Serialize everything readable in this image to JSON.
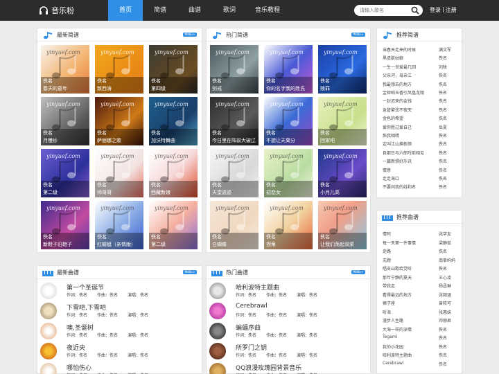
{
  "header": {
    "logo_text": "音乐粉",
    "nav": [
      "首页",
      "简谱",
      "曲谱",
      "歌词",
      "音乐教程"
    ],
    "search_placeholder": "请输入歌名",
    "login": "登录",
    "sep": "|",
    "register": "注册",
    "active_color": "#2f8fe6"
  },
  "latest_jianpu": {
    "title": "最新简谱",
    "more": "MORE>>",
    "items": [
      {
        "name": "佚名",
        "sub": "春天的童年",
        "wm": "yinyuef.com"
      },
      {
        "name": "佚名",
        "sub": "致西涛",
        "wm": "yinyuef.com"
      },
      {
        "name": "佚名",
        "sub": "第四级",
        "wm": "yinyuef.com"
      },
      {
        "name": "佚名",
        "sub": "月慢纱",
        "wm": "yinyuef.com"
      },
      {
        "name": "佚名",
        "sub": "萨丽娜之歌",
        "wm": "yinyuef.com"
      },
      {
        "name": "佚名",
        "sub": "加沃特舞曲",
        "wm": "yinyuef.com"
      },
      {
        "name": "佚名",
        "sub": "第二级",
        "wm": "yinyuef.com"
      },
      {
        "name": "佚名",
        "sub": "帅哥哥",
        "wm": "yinyuef.com"
      },
      {
        "name": "佚名",
        "sub": "西藏新娘",
        "wm": "yinyuef.com"
      },
      {
        "name": "佚名",
        "sub": "新鞋子旧鞋子",
        "wm": "yinyuef.com"
      },
      {
        "name": "佚名",
        "sub": "红蜻蜓（亲情版）",
        "wm": "yinyuef.com"
      },
      {
        "name": "佚名",
        "sub": "第二级",
        "wm": "yinyuef.com"
      }
    ]
  },
  "hot_jianpu": {
    "title": "热门简谱",
    "more": "MORE>>",
    "items": [
      {
        "name": "佚名",
        "sub": "别戒",
        "wm": "yinyuef.com"
      },
      {
        "name": "佚名",
        "sub": "你的名字我的姓氏",
        "wm": "yinyuef.com"
      },
      {
        "name": "佚名",
        "sub": "赎罪",
        "wm": "yinyuef.com"
      },
      {
        "name": "佚名",
        "sub": "今日里在阵前大破辽兵",
        "wm": "yinyuef.com"
      },
      {
        "name": "佚名",
        "sub": "不想让天离分",
        "wm": "yinyuef.com"
      },
      {
        "name": "佚名",
        "sub": "回家吧",
        "wm": "yinyuef.com"
      },
      {
        "name": "佚名",
        "sub": "天堂遗迹",
        "wm": "yinyuef.com"
      },
      {
        "name": "佚名",
        "sub": "初恋女",
        "wm": "yinyuef.com"
      },
      {
        "name": "佚名",
        "sub": "小月儿高",
        "wm": "yinyuef.com"
      },
      {
        "name": "佚名",
        "sub": "白蝴蝶",
        "wm": "yinyuef.com"
      },
      {
        "name": "佚名",
        "sub": "拐角",
        "wm": "yinyuef.com"
      },
      {
        "name": "佚名",
        "sub": "让我们荡起双桨",
        "wm": "yinyuef.com"
      }
    ]
  },
  "recommend_jianpu": {
    "title": "推荐简谱",
    "items": [
      {
        "song": "当春天走来的时候",
        "artist": "满文军"
      },
      {
        "song": "黑皮肤姑娘",
        "artist": "佚名"
      },
      {
        "song": "一生一世爱最几回",
        "artist": "刘牧"
      },
      {
        "song": "父亲河，母亲江",
        "artist": "佚名"
      },
      {
        "song": "我最想去的地方",
        "artist": "佚名"
      },
      {
        "song": "金钟响玉香引凤凰龙翔",
        "artist": "佚名"
      },
      {
        "song": "一封迟来的金钱",
        "artist": "佚名"
      },
      {
        "song": "急管繁弦不夜天",
        "artist": "佚名"
      },
      {
        "song": "金色的希望",
        "artist": "佚名"
      },
      {
        "song": "爱你胜过爱自己",
        "artist": "岳夏"
      },
      {
        "song": "炼我相晴",
        "artist": "佚名"
      },
      {
        "song": "定叫江山换新颜",
        "artist": "佚名"
      },
      {
        "song": "自那日与六郎阵前相见",
        "artist": "佚名"
      },
      {
        "song": "一篇新颁好乐讯",
        "artist": "佚名"
      },
      {
        "song": "情意",
        "artist": "佚名"
      },
      {
        "song": "走走海口",
        "artist": "佚名"
      },
      {
        "song": "不要问我的姓和名",
        "artist": "佚名"
      }
    ]
  },
  "recommend_qupu": {
    "title": "推荐曲谱",
    "items": [
      {
        "song": "情阿",
        "artist": "张学友"
      },
      {
        "song": "每一天第一件事情",
        "artist": "梁静茹"
      },
      {
        "song": "走路",
        "artist": "佚名"
      },
      {
        "song": "无题",
        "artist": "南拳妈妈"
      },
      {
        "song": "唱支山歌给党听",
        "artist": "佚名"
      },
      {
        "song": "那年宁静的夏天",
        "artist": "王心凌"
      },
      {
        "song": "带我走",
        "artist": "杨丞琳"
      },
      {
        "song": "看得最远的地方",
        "artist": "张韶涵"
      },
      {
        "song": "狮子座",
        "artist": "曾轶可"
      },
      {
        "song": "听海",
        "artist": "张惠妹"
      },
      {
        "song": "漫步人生路",
        "artist": "邓丽君"
      },
      {
        "song": "大海一样的深情",
        "artist": "佚名"
      },
      {
        "song": "Tegami",
        "artist": "佚名"
      },
      {
        "song": "我的小花园",
        "artist": "佚名"
      },
      {
        "song": "哈利波特主题曲",
        "artist": "佚名"
      },
      {
        "song": "Cerebrawl",
        "artist": "佚名"
      }
    ]
  },
  "latest_qupu": {
    "title": "最新曲谱",
    "more": "MORE>>",
    "lyric_label": "作词：佚名",
    "compose_label": "作曲：佚名",
    "perform_label": "演唱：佚名",
    "items": [
      {
        "title": "第一个圣诞节"
      },
      {
        "title": "下雪吧,下雪吧"
      },
      {
        "title": "噢,圣诞树"
      },
      {
        "title": "夜近央"
      },
      {
        "title": "哪怕伤心"
      }
    ]
  },
  "hot_qupu": {
    "title": "热门曲谱",
    "more": "MORE>>",
    "lyric_label": "作词：佚名",
    "compose_label": "作曲：佚名",
    "perform_label": "演唱：佚名",
    "items": [
      {
        "title": "哈利波特主题曲"
      },
      {
        "title": "Cerebrawl"
      },
      {
        "title": "蝙蝠序曲"
      },
      {
        "title": "所罗门之钥"
      },
      {
        "title": "QQ浪漫玫瑰园背景音乐"
      }
    ]
  }
}
